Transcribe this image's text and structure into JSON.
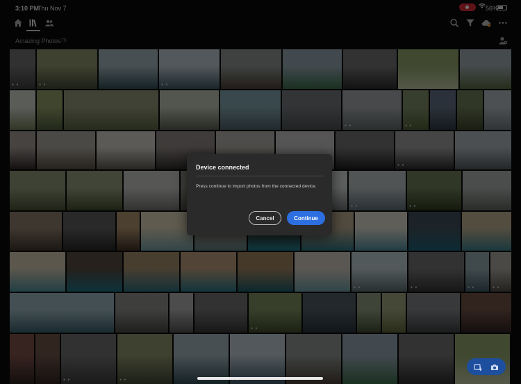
{
  "status_bar": {
    "time": "3:10 PM",
    "date": "Thu Nov 7",
    "battery": "56%"
  },
  "toolbar": {
    "left_icons": [
      "home-icon",
      "library-icon",
      "people-icon"
    ],
    "right_icons": [
      "search-icon",
      "filter-icon",
      "cloud-sync-icon",
      "more-icon"
    ]
  },
  "album": {
    "title": "Amazing Photos",
    "count": "76"
  },
  "dialog": {
    "title": "Device connected",
    "message": "Press continue to import photos from the connected device.",
    "cancel_label": "Cancel",
    "continue_label": "Continue"
  },
  "colors": {
    "accent_blue": "#2d6fe0",
    "record_red": "#d12a35",
    "dialog_bg": "#2a2a2a"
  },
  "photos": [
    {
      "c1": "#6d6d6d",
      "c2": "#3b3b3b",
      "stars": true
    },
    {
      "c1": "#8a8f6a",
      "c2": "#3e4632",
      "stars": true
    },
    {
      "c1": "#9fb0b6",
      "c2": "#2e4a52",
      "stars": false
    },
    {
      "c1": "#b6c4c9",
      "c2": "#3b5563",
      "stars": true
    },
    {
      "c1": "#8a918e",
      "c2": "#4a3d36",
      "stars": false
    },
    {
      "c1": "#93a3ad",
      "c2": "#3a6a4a",
      "stars": false
    },
    {
      "c1": "#707070",
      "c2": "#2a2a2a",
      "stars": false
    },
    {
      "c1": "#8ea06a",
      "c2": "#b9c1a0",
      "stars": false
    },
    {
      "c1": "#9aa4a8",
      "c2": "#56663f",
      "stars": false
    },
    {
      "c1": "#c8ccc4",
      "c2": "#6c7a55",
      "stars": false
    },
    {
      "c1": "#8f9a66",
      "c2": "#4c5a3a",
      "stars": false
    },
    {
      "c1": "#8d9273",
      "c2": "#556142",
      "stars": false
    },
    {
      "c1": "#b8bdb0",
      "c2": "#565a4e",
      "stars": false
    },
    {
      "c1": "#7fa0aa",
      "c2": "#4b5d63",
      "stars": false
    },
    {
      "c1": "#6f7478",
      "c2": "#494d50",
      "stars": false
    },
    {
      "c1": "#9ea2a4",
      "c2": "#5f6567",
      "stars": true
    },
    {
      "c1": "#7d8a64",
      "c2": "#4e5b34",
      "stars": true
    },
    {
      "c1": "#5f6e80",
      "c2": "#2d3643",
      "stars": false
    },
    {
      "c1": "#6d7a56",
      "c2": "#3a432a",
      "stars": false
    },
    {
      "c1": "#aab2b6",
      "c2": "#6b7378",
      "stars": false
    },
    {
      "c1": "#9c9490",
      "c2": "#2c2624",
      "stars": false
    },
    {
      "c1": "#a6a29a",
      "c2": "#544a40",
      "stars": false
    },
    {
      "c1": "#c9c8c2",
      "c2": "#5c5650",
      "stars": false
    },
    {
      "c1": "#8a8480",
      "c2": "#2e2a26",
      "stars": false
    },
    {
      "c1": "#b0aca6",
      "c2": "#4b4640",
      "stars": false
    },
    {
      "c1": "#bcbcbc",
      "c2": "#6b6b6b",
      "stars": false
    },
    {
      "c1": "#707070",
      "c2": "#1e1e1e",
      "stars": false
    },
    {
      "c1": "#9a9a9a",
      "c2": "#2a2a2a",
      "stars": true
    },
    {
      "c1": "#a7afb3",
      "c2": "#4f575b",
      "stars": false
    },
    {
      "c1": "#8b9376",
      "c2": "#475035",
      "stars": false
    },
    {
      "c1": "#909a7c",
      "c2": "#3e4a2c",
      "stars": false
    },
    {
      "c1": "#bfc1bd",
      "c2": "#6e716c",
      "stars": false
    },
    {
      "c1": "#8a8c80",
      "c2": "#4e5044",
      "stars": false
    },
    {
      "c1": "#a3a5a0",
      "c2": "#5c5e58",
      "stars": false
    },
    {
      "c1": "#cfd3d3",
      "c2": "#6a6e70",
      "stars": false
    },
    {
      "c1": "#b3babc",
      "c2": "#5a6b72",
      "stars": true
    },
    {
      "c1": "#6c7a56",
      "c2": "#2f3a1f",
      "stars": true
    },
    {
      "c1": "#a4aba6",
      "c2": "#5d625e",
      "stars": false
    },
    {
      "c1": "#8b7b6a",
      "c2": "#3d332a",
      "stars": false
    },
    {
      "c1": "#5c5c5c",
      "c2": "#252525",
      "stars": false
    },
    {
      "c1": "#a98e6c",
      "c2": "#3c2f22",
      "stars": false
    },
    {
      "c1": "#d2c9b0",
      "c2": "#6f9aa0",
      "stars": false
    },
    {
      "c1": "#b7ad98",
      "c2": "#5c7a7e",
      "stars": false
    },
    {
      "c1": "#4a4038",
      "c2": "#1d7a8a",
      "stars": false
    },
    {
      "c1": "#b4a58a",
      "c2": "#2c6f7e",
      "stars": false
    },
    {
      "c1": "#d5d0c4",
      "c2": "#4c8898",
      "stars": false
    },
    {
      "c1": "#3e4f5a",
      "c2": "#1e5f72",
      "stars": false
    },
    {
      "c1": "#b8aa8c",
      "c2": "#3c7c8a",
      "stars": false
    },
    {
      "c1": "#c9c0aa",
      "c2": "#4d8c98",
      "stars": false
    },
    {
      "c1": "#54493f",
      "c2": "#1f6f80",
      "stars": false
    },
    {
      "c1": "#9d8a6c",
      "c2": "#2d6c7b",
      "stars": false
    },
    {
      "c1": "#b59a7a",
      "c2": "#2a7485",
      "stars": false
    },
    {
      "c1": "#9a7f5e",
      "c2": "#1e5a66",
      "stars": false
    },
    {
      "c1": "#c8c2b6",
      "c2": "#6a9aa2",
      "stars": false
    },
    {
      "c1": "#b5c5c8",
      "c2": "#5a6a6c",
      "stars": true
    },
    {
      "c1": "#707070",
      "c2": "#333333",
      "stars": true
    },
    {
      "c1": "#8fa3a8",
      "c2": "#3e5660",
      "stars": true
    },
    {
      "c1": "#a7a39b",
      "c2": "#4e4b45",
      "stars": true
    },
    {
      "c1": "#98b0ba",
      "c2": "#3a5e6a",
      "stars": false
    },
    {
      "c1": "#8a8a86",
      "c2": "#44443f",
      "stars": false
    },
    {
      "c1": "#a8a8a8",
      "c2": "#505050",
      "stars": false
    },
    {
      "c1": "#6f6f6f",
      "c2": "#353535",
      "stars": false
    },
    {
      "c1": "#7a8c5e",
      "c2": "#3f4a2c",
      "stars": true
    },
    {
      "c1": "#4e5a63",
      "c2": "#27303a",
      "stars": false
    },
    {
      "c1": "#8b9a7c",
      "c2": "#3e4a30",
      "stars": false
    },
    {
      "c1": "#9aa07a",
      "c2": "#5a6238",
      "stars": false
    },
    {
      "c1": "#7b7f80",
      "c2": "#3a3e40",
      "stars": false
    },
    {
      "c1": "#6e4e44",
      "c2": "#2e2220",
      "stars": false
    },
    {
      "c1": "#7b4f46",
      "c2": "#2c2220",
      "stars": false
    },
    {
      "c1": "#6e5248",
      "c2": "#2e2420",
      "stars": false
    }
  ]
}
